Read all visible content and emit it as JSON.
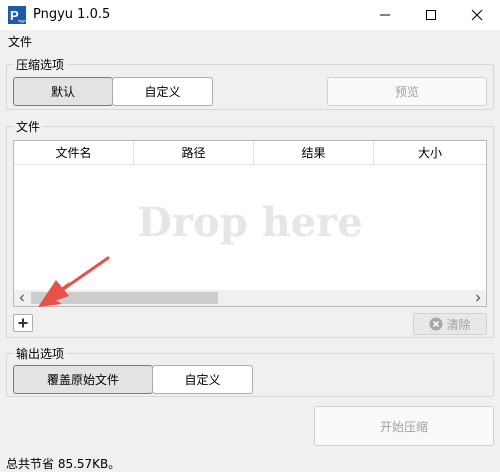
{
  "window": {
    "title": "Pngyu 1.0.5",
    "icon_letter": "P",
    "icon_sub": "ngyu",
    "minimize_icon": "minimize-icon",
    "maximize_icon": "maximize-icon",
    "close_icon": "close-icon"
  },
  "menu": {
    "file": "文件"
  },
  "compress_options": {
    "label": "压缩选项",
    "default_btn": "默认",
    "custom_btn": "自定义",
    "preview_btn": "预览"
  },
  "files": {
    "label": "文件",
    "columns": [
      "文件名",
      "路径",
      "结果",
      "大小"
    ],
    "drop_hint": "Drop here",
    "add_icon": "plus-icon",
    "clear_btn": "清除",
    "clear_icon": "clear-circle-icon"
  },
  "output_options": {
    "label": "输出选项",
    "overwrite_btn": "覆盖原始文件",
    "custom_btn": "自定义"
  },
  "start_btn": "开始压缩",
  "status": "总共节省 85.57KB。",
  "colors": {
    "annotation_arrow": "#e8504a",
    "drop_text": "#e6e6e6"
  }
}
